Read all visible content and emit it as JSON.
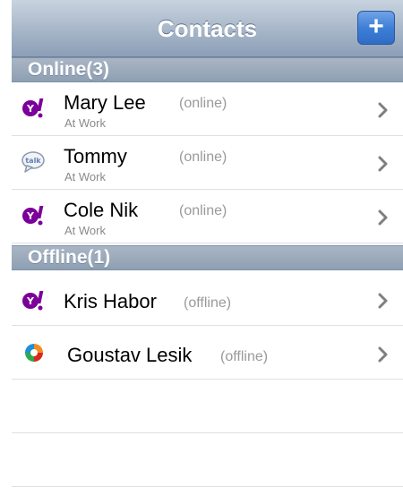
{
  "navbar": {
    "title": "Contacts",
    "add_label": "+"
  },
  "sections": {
    "online": {
      "header": "Online(3)",
      "contacts": [
        {
          "name": "Mary Lee",
          "subtitle": "At Work",
          "status": "(online)",
          "icon": "yahoo-icon"
        },
        {
          "name": "Tommy",
          "subtitle": "At Work",
          "status": "(online)",
          "icon": "gtalk-icon"
        },
        {
          "name": "Cole Nik",
          "subtitle": "At Work",
          "status": "(online)",
          "icon": "yahoo-icon"
        }
      ]
    },
    "offline": {
      "header": "Offline(1)",
      "contacts": [
        {
          "name": "Kris Habor",
          "status": "(offline)",
          "icon": "yahoo-icon"
        },
        {
          "name": "Goustav Lesik",
          "status": "(offline)",
          "icon": "icq-icon"
        }
      ]
    }
  },
  "colors": {
    "yahoo": "#7b0099",
    "navbar": "#a9b8ca",
    "button": "#3f7fd6",
    "section_header": "#8f9fb3"
  }
}
